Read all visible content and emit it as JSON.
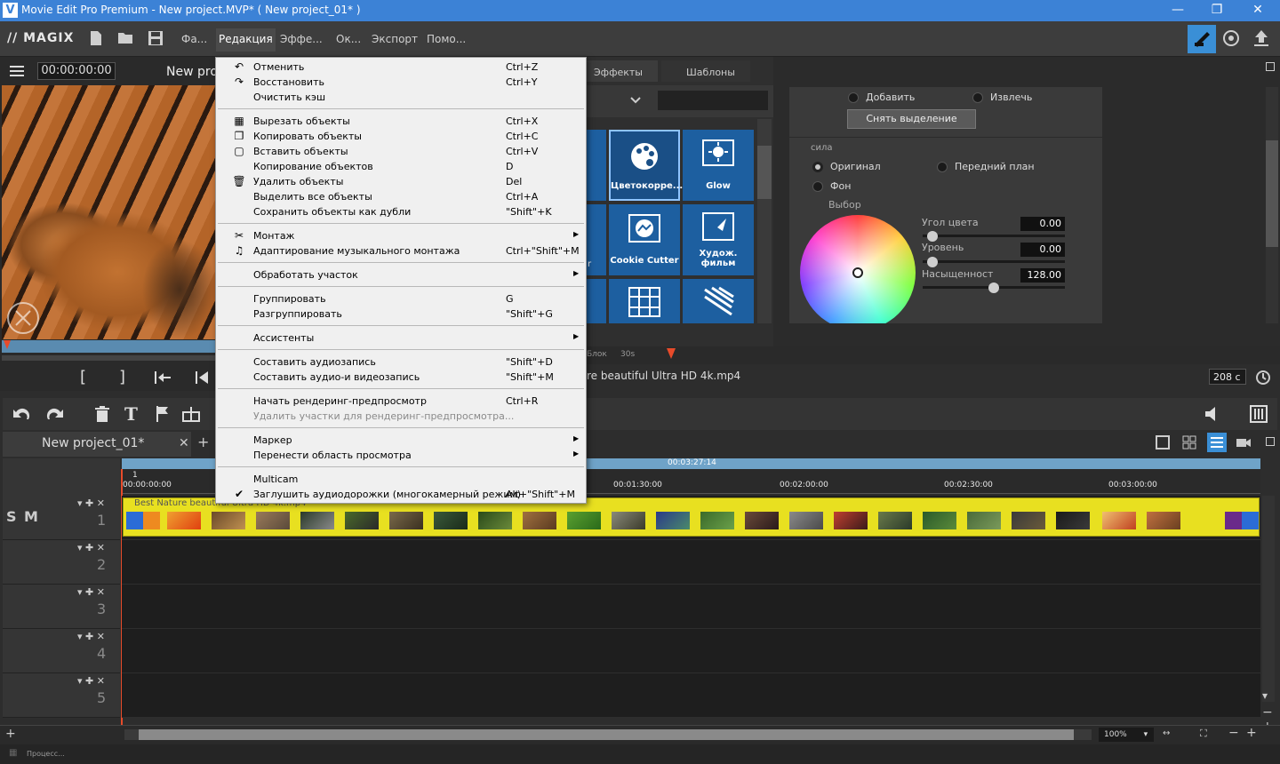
{
  "window": {
    "title": "Movie Edit Pro Premium - New project.MVP* ( New project_01* )",
    "minimize": "—",
    "restore": "❐",
    "close": "✕"
  },
  "menubar": {
    "logo": "MAGIX",
    "items": [
      "Фа...",
      "Редакция",
      "Эффе...",
      "Ок...",
      "Экспорт",
      "Помо..."
    ],
    "active_index": 1
  },
  "preview": {
    "timecode": "00:00:00:00",
    "project_name": "New pro",
    "brackets_in": "[",
    "brackets_out": "]"
  },
  "effects": {
    "tabs": [
      "Эффекты",
      "Шаблоны"
    ],
    "cells": [
      {
        "label": "Цветокорре...",
        "icon": "palette-icon",
        "selected": true
      },
      {
        "label": "Glow",
        "icon": "glow-icon"
      },
      {
        "label": "Cookie Cutter",
        "icon": "cookie-cutter-icon"
      },
      {
        "label": "Худож. фильм",
        "icon": "art-film-icon"
      },
      {
        "label": "",
        "icon": "grid-warp-icon"
      },
      {
        "label": "",
        "icon": "stripes-icon"
      }
    ],
    "partial_label": "r"
  },
  "props": {
    "add": "Добавить",
    "extract": "Извлечь",
    "deselect": "Снять выделение",
    "strength_label": "сила",
    "original": "Оригинал",
    "foreground": "Передний план",
    "background": "Фон",
    "select_label": "Выбор",
    "hue_label": "Угол цвета",
    "hue_value": "0.00",
    "level_label": "Уровень",
    "level_value": "0.00",
    "saturation_label": "Насыщенност",
    "saturation_value": "128.00"
  },
  "infostrip": {
    "block_label": "Блок",
    "time_label": "30s",
    "clip_name": "re beautiful Ultra HD 4k.mp4",
    "duration": "208 с"
  },
  "timeline": {
    "tab_name": "New project_01*",
    "total_time": "00:03:27:14",
    "marker_num": "1",
    "ruler_ticks": [
      "00:00:00:00",
      "00:01:30:00",
      "00:02:00:00",
      "00:02:30:00",
      "00:03:00:00"
    ],
    "clip_name": "Best Nature beautiful Ultra HD 4k.mp4",
    "track_numbers": [
      "1",
      "2",
      "3",
      "4",
      "5"
    ],
    "track1_s": "S",
    "track1_m": "M",
    "zoom": "100%",
    "status": "Процесс..."
  },
  "context_menu": {
    "groups": [
      [
        {
          "icon": "undo-icon",
          "label": "Отменить",
          "shortcut": "Ctrl+Z"
        },
        {
          "icon": "redo-icon",
          "label": "Восстановить",
          "shortcut": "Ctrl+Y"
        },
        {
          "icon": "",
          "label": "Очистить кэш",
          "shortcut": ""
        }
      ],
      [
        {
          "icon": "cut-icon",
          "label": "Вырезать объекты",
          "shortcut": "Ctrl+X"
        },
        {
          "icon": "copy-icon",
          "label": "Копировать объекты",
          "shortcut": "Ctrl+C"
        },
        {
          "icon": "paste-icon",
          "label": "Вставить объекты",
          "shortcut": "Ctrl+V"
        },
        {
          "icon": "",
          "label": "Копирование объектов",
          "shortcut": "D"
        },
        {
          "icon": "trash-icon",
          "label": "Удалить объекты",
          "shortcut": "Del"
        },
        {
          "icon": "",
          "label": "Выделить все объекты",
          "shortcut": "Ctrl+A"
        },
        {
          "icon": "",
          "label": "Сохранить объекты как дубли",
          "shortcut": "\"Shift\"+K"
        }
      ],
      [
        {
          "icon": "scissors-icon",
          "label": "Монтаж",
          "shortcut": "",
          "submenu": true
        },
        {
          "icon": "music-montage-icon",
          "label": "Адаптирование музыкального монтажа",
          "shortcut": "Ctrl+\"Shift\"+M"
        }
      ],
      [
        {
          "icon": "",
          "label": "Обработать участок",
          "shortcut": "",
          "submenu": true
        }
      ],
      [
        {
          "icon": "",
          "label": "Группировать",
          "shortcut": "G"
        },
        {
          "icon": "",
          "label": "Разгруппировать",
          "shortcut": "\"Shift\"+G"
        }
      ],
      [
        {
          "icon": "",
          "label": "Ассистенты",
          "shortcut": "",
          "submenu": true
        }
      ],
      [
        {
          "icon": "",
          "label": "Составить аудиозапись",
          "shortcut": "\"Shift\"+D"
        },
        {
          "icon": "",
          "label": "Составить аудио-и видеозапись",
          "shortcut": "\"Shift\"+M"
        }
      ],
      [
        {
          "icon": "",
          "label": "Начать рендеринг-предпросмотр",
          "shortcut": "Ctrl+R"
        },
        {
          "icon": "",
          "label": "Удалить участки для рендеринг-предпросмотра...",
          "shortcut": "",
          "disabled": true
        }
      ],
      [
        {
          "icon": "",
          "label": "Маркер",
          "shortcut": "",
          "submenu": true
        },
        {
          "icon": "",
          "label": "Перенести область просмотра",
          "shortcut": "",
          "submenu": true
        }
      ],
      [
        {
          "icon": "",
          "label": "Multicam",
          "shortcut": ""
        },
        {
          "icon": "check-icon",
          "label": "Заглушить аудиодорожки (многокамерный режим)",
          "shortcut": "Alt+\"Shift\"+M"
        }
      ]
    ]
  }
}
